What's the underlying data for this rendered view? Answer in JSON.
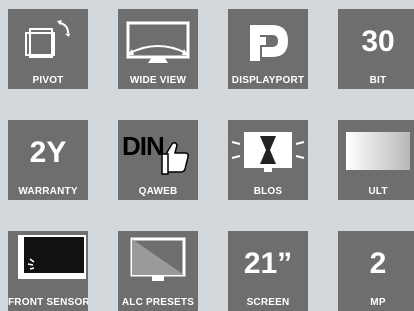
{
  "features": [
    {
      "id": "pivot",
      "caption": "PIVOT",
      "icon": "pivot-rotate-icon"
    },
    {
      "id": "wide-view",
      "caption": "WIDE VIEW",
      "icon": "wide-view-monitor-icon"
    },
    {
      "id": "displayport",
      "caption": "DISPLAYPORT",
      "icon": "displayport-logo-icon"
    },
    {
      "id": "30bit",
      "caption": "BIT",
      "value": "30"
    },
    {
      "id": "warranty",
      "caption": "WARRANTY",
      "value": "2Y"
    },
    {
      "id": "qaweb",
      "caption": "QAWEB",
      "icon": "din-thumbs-up-icon",
      "icon_text": "DIN"
    },
    {
      "id": "blos",
      "caption": "BLOS",
      "icon": "hourglass-monitor-icon"
    },
    {
      "id": "ult",
      "caption": "ULT",
      "icon": "uniform-light-monitor-icon"
    },
    {
      "id": "front-sensor",
      "caption": "FRONT SENSOR",
      "icon": "front-sensor-monitor-icon"
    },
    {
      "id": "alc-presets",
      "caption": "ALC PRESETS",
      "icon": "alc-monitor-icon"
    },
    {
      "id": "screen",
      "caption": "SCREEN",
      "value": "21”"
    },
    {
      "id": "mp",
      "caption": "MP",
      "value": "2"
    }
  ],
  "colors": {
    "tile": "#6e6e6e",
    "background": "#d3d8dc",
    "foreground": "#ffffff"
  }
}
